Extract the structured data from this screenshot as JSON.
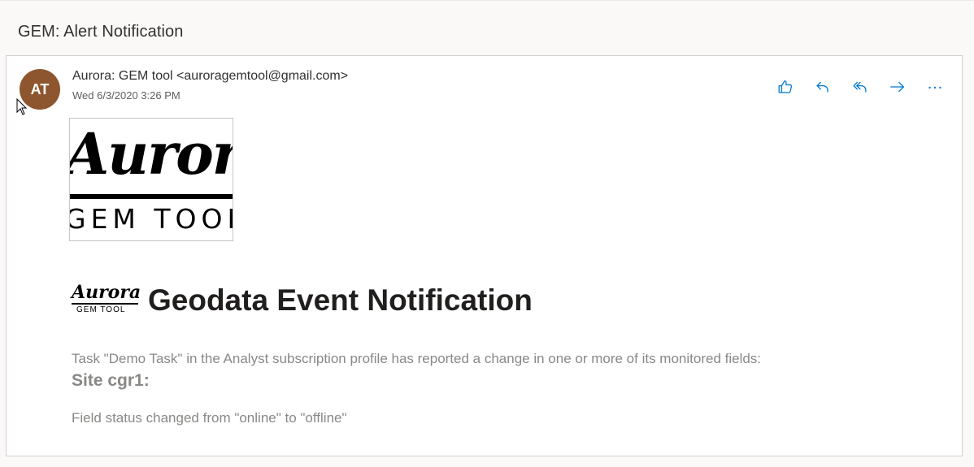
{
  "header": {
    "subject": "GEM: Alert Notification"
  },
  "message": {
    "avatar_initials": "AT",
    "avatar_color": "#8e562e",
    "sender": "Aurora: GEM tool <auroragemtool@gmail.com>",
    "date": "Wed 6/3/2020 3:26 PM",
    "actions": [
      {
        "name": "like-icon",
        "label": "Like"
      },
      {
        "name": "reply-icon",
        "label": "Reply"
      },
      {
        "name": "reply-all-icon",
        "label": "Reply all"
      },
      {
        "name": "forward-icon",
        "label": "Forward"
      },
      {
        "name": "more-icon",
        "label": "More actions"
      }
    ],
    "accent_color": "#0078d4"
  },
  "body": {
    "logo_script": "Aurora",
    "logo_sub": "GEM TOOL",
    "headline_logo_script": "Aurora",
    "headline_logo_sub": "GEM TOOL",
    "headline": "Geodata Event Notification",
    "intro": "Task \"Demo Task\" in the Analyst subscription profile has reported a change in one or more of its monitored fields:",
    "site": "Site cgr1:",
    "field_change": "Field status changed from \"online\" to \"offline\""
  }
}
